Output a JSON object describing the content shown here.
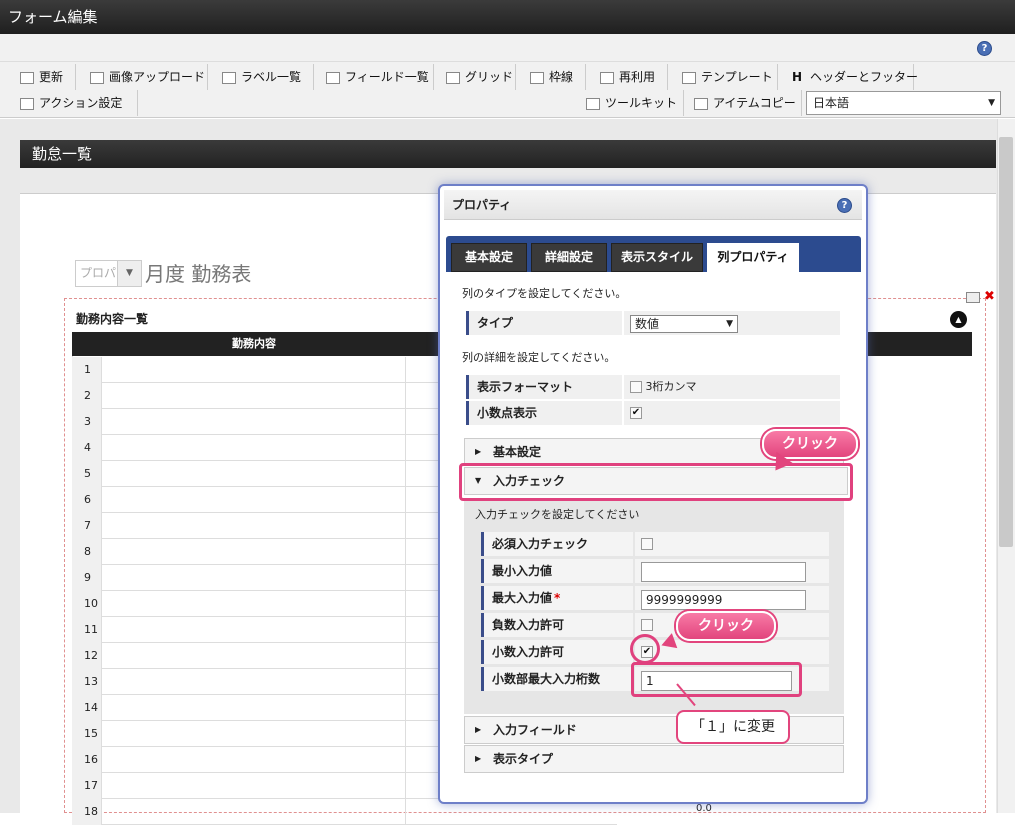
{
  "app": {
    "title": "フォーム編集"
  },
  "toolbar": {
    "row1": [
      {
        "label": "更新",
        "icon": "update-icon"
      },
      {
        "label": "画像アップロード",
        "icon": "image-upload-icon"
      },
      {
        "label": "ラベル一覧",
        "icon": "label-list-icon"
      },
      {
        "label": "フィールド一覧",
        "icon": "field-list-icon"
      },
      {
        "label": "グリッド",
        "icon": "grid-icon"
      },
      {
        "label": "枠線",
        "icon": "border-icon"
      },
      {
        "label": "再利用",
        "icon": "reuse-icon"
      },
      {
        "label": "テンプレート",
        "icon": "template-icon"
      },
      {
        "label": "ヘッダーとフッター",
        "icon": "header-footer-icon"
      }
    ],
    "action_label": "アクション設定",
    "toolkit_label": "ツールキット",
    "itemcopy_label": "アイテムコピー",
    "language": "日本語"
  },
  "form": {
    "title": "勤怠一覧",
    "month_placeholder": "プロパ",
    "month_title": "月度 勤務表",
    "list_title": "勤務内容一覧",
    "column_header": "勤務内容",
    "rows": [
      "1",
      "2",
      "3",
      "4",
      "5",
      "6",
      "7",
      "8",
      "9",
      "10",
      "11",
      "12",
      "13",
      "14",
      "15",
      "16",
      "17",
      "18"
    ],
    "last_value": "0.0"
  },
  "panel": {
    "title": "プロパティ",
    "tabs": [
      "基本設定",
      "詳細設定",
      "表示スタイル",
      "列プロパティ"
    ],
    "active_tab": 3,
    "type_hint": "列のタイプを設定してください。",
    "type_label": "タイプ",
    "type_value": "数値",
    "detail_hint": "列の詳細を設定してください。",
    "format_label": "表示フォーマット",
    "format_value": "3桁カンマ",
    "decimal_label": "小数点表示",
    "sec_basic": "基本設定",
    "sec_input_check": "入力チェック",
    "input_check_hint": "入力チェックを設定してください",
    "required_label": "必須入力チェック",
    "min_label": "最小入力値",
    "min_value": "",
    "max_label": "最大入力値",
    "max_required_mark": "*",
    "max_value": "9999999999",
    "negative_label": "負数入力許可",
    "decimal_allow_label": "小数入力許可",
    "decimal_digits_label": "小数部最大入力桁数",
    "decimal_digits_value": "1",
    "sec_input_field": "入力フィールド",
    "sec_display_type": "表示タイプ"
  },
  "annotations": {
    "click1": "クリック",
    "click2": "クリック",
    "change": "「１」に変更"
  },
  "colors": {
    "accent": "#e2457d",
    "tab_bar": "#2c4b8f",
    "header": "#222222"
  }
}
